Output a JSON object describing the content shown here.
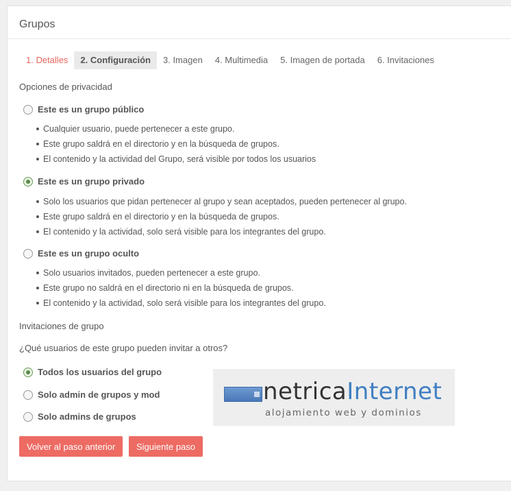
{
  "panel": {
    "title": "Grupos"
  },
  "tabs": [
    {
      "label": "1. Detalles"
    },
    {
      "label": "2. Configuración"
    },
    {
      "label": "3. Imagen"
    },
    {
      "label": "4. Multimedia"
    },
    {
      "label": "5. Imagen de portada"
    },
    {
      "label": "6. Invitaciones"
    }
  ],
  "privacy": {
    "heading": "Opciones de privacidad",
    "options": [
      {
        "label": "Este es un grupo público",
        "checked": false,
        "bullets": [
          "Cualquier usuario, puede pertenecer a este grupo.",
          "Este grupo saldrá en el directorio y en la búsqueda de grupos.",
          "El contenido y la actividad del Grupo, será visible por todos los usuarios"
        ]
      },
      {
        "label": "Este es un grupo privado",
        "checked": true,
        "bullets": [
          "Solo los usuarios que pidan pertenecer al grupo y sean aceptados, pueden pertenecer al grupo.",
          "Este grupo saldrá en el directorio y en la búsqueda de grupos.",
          "El contenido y la actividad, solo será visible para los integrantes del grupo."
        ]
      },
      {
        "label": "Este es un grupo oculto",
        "checked": false,
        "bullets": [
          "Solo usuarios invitados, pueden pertenecer a este grupo.",
          "Este grupo no saldrá en el directorio ni en la búsqueda de grupos.",
          "El contenido y la actividad, solo será visible para los integrantes del grupo."
        ]
      }
    ]
  },
  "invitations": {
    "heading": "Invitaciones de grupo",
    "question": "¿Qué usuarios de este grupo pueden invitar a otros?",
    "options": [
      {
        "label": "Todos los usuarios del grupo",
        "checked": true
      },
      {
        "label": "Solo admin de grupos y mod",
        "checked": false
      },
      {
        "label": "Solo admins de grupos",
        "checked": false
      }
    ]
  },
  "logo": {
    "word1": "netrica",
    "word2": "Internet",
    "tagline": "alojamiento web y dominios"
  },
  "buttons": {
    "back": "Volver al paso anterior",
    "next": "Siguiente paso"
  },
  "colors": {
    "accent": "#ed6b63",
    "tab_done": "#e8655e",
    "logo_blue": "#3f7fc2"
  }
}
